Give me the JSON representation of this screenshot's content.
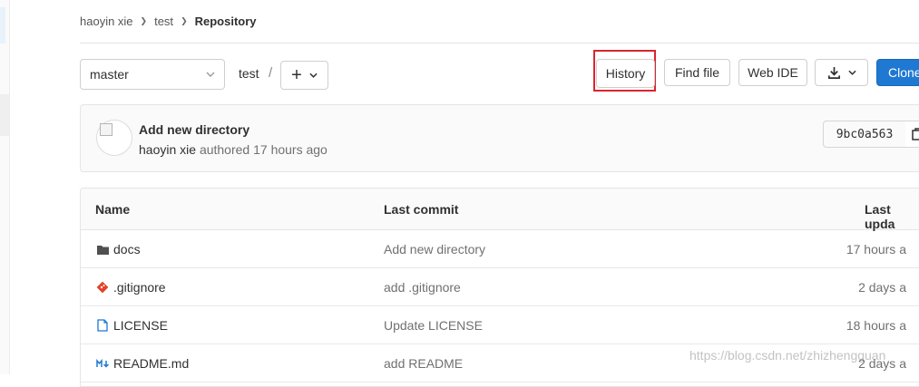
{
  "breadcrumbs": {
    "user": "haoyin xie",
    "project": "test",
    "current": "Repository"
  },
  "toolbar": {
    "branch": "master",
    "path_root": "test",
    "path_separator": "/",
    "history_label": "History",
    "find_file_label": "Find file",
    "web_ide_label": "Web IDE",
    "clone_label": "Clone"
  },
  "last_commit": {
    "title": "Add new directory",
    "author": "haoyin xie",
    "authored": "authored",
    "time": "17 hours ago",
    "sha": "9bc0a563"
  },
  "table": {
    "headers": {
      "name": "Name",
      "last_commit": "Last commit",
      "last_update": "Last upda"
    },
    "rows": [
      {
        "name": "docs",
        "icon": "folder-icon",
        "commit": "Add new directory",
        "updated": "17 hours a"
      },
      {
        "name": ".gitignore",
        "icon": "git-icon",
        "commit": "add .gitignore",
        "updated": "2 days a"
      },
      {
        "name": "LICENSE",
        "icon": "file-icon",
        "commit": "Update LICENSE",
        "updated": "18 hours a"
      },
      {
        "name": "README.md",
        "icon": "markdown-icon",
        "commit": "add README",
        "updated": "2 days a"
      }
    ]
  },
  "watermark": "https://blog.csdn.net/zhizhengguan",
  "colors": {
    "primary": "#1f78d1",
    "highlight_box": "#d8262e",
    "git_icon": "#e24329",
    "file_icon": "#1f78d1"
  }
}
